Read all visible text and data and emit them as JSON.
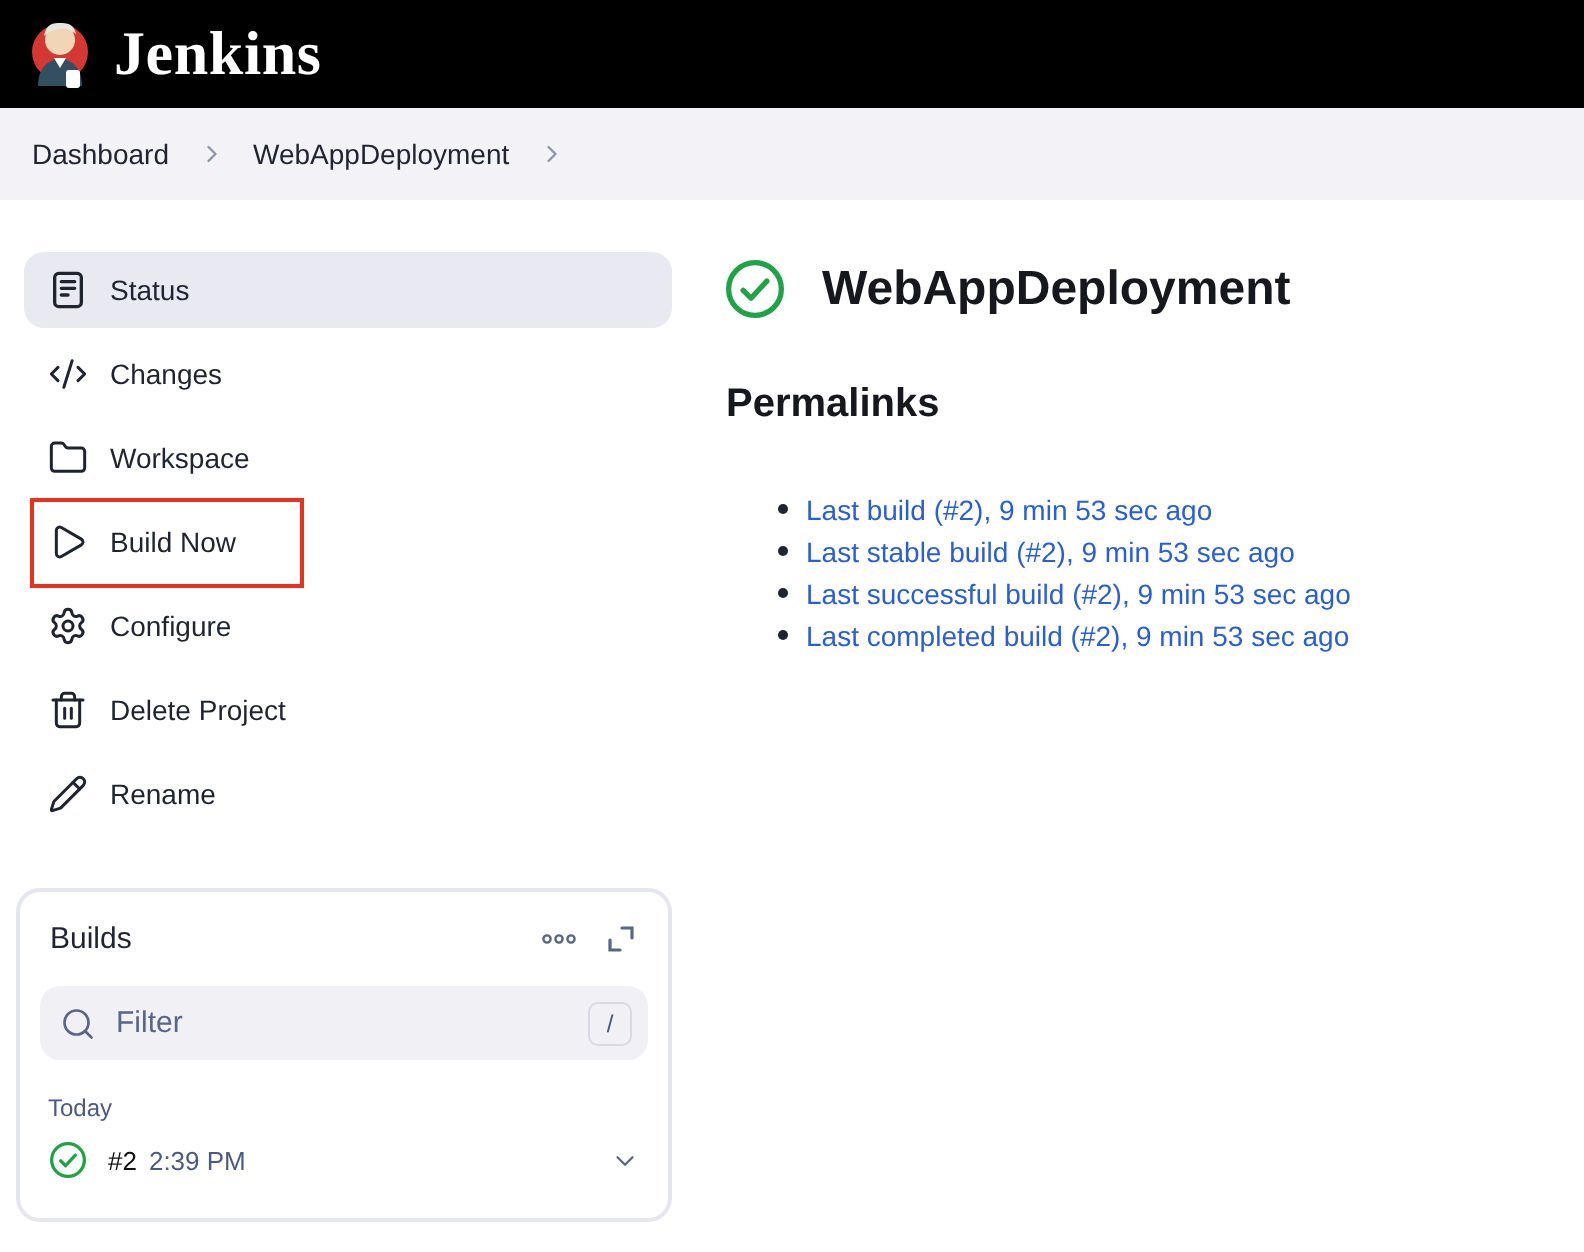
{
  "header": {
    "brand": "Jenkins"
  },
  "breadcrumbs": [
    {
      "label": "Dashboard"
    },
    {
      "label": "WebAppDeployment"
    }
  ],
  "sidebar": {
    "items": [
      {
        "label": "Status",
        "selected": true,
        "highlighted": false
      },
      {
        "label": "Changes",
        "selected": false,
        "highlighted": false
      },
      {
        "label": "Workspace",
        "selected": false,
        "highlighted": false
      },
      {
        "label": "Build Now",
        "selected": false,
        "highlighted": true
      },
      {
        "label": "Configure",
        "selected": false,
        "highlighted": false
      },
      {
        "label": "Delete Project",
        "selected": false,
        "highlighted": false
      },
      {
        "label": "Rename",
        "selected": false,
        "highlighted": false
      }
    ]
  },
  "builds": {
    "title": "Builds",
    "filter": {
      "placeholder": "Filter",
      "shortcut": "/"
    },
    "groups": [
      {
        "label": "Today",
        "builds": [
          {
            "number": "#2",
            "time": "2:39 PM",
            "passed": true
          }
        ]
      }
    ]
  },
  "main": {
    "title": "WebAppDeployment",
    "passed": true,
    "permalinks": {
      "heading": "Permalinks",
      "links": [
        "Last build (#2), 9 min 53 sec ago",
        "Last stable build (#2), 9 min 53 sec ago",
        "Last successful build (#2), 9 min 53 sec ago",
        "Last completed build (#2), 9 min 53 sec ago"
      ]
    }
  }
}
